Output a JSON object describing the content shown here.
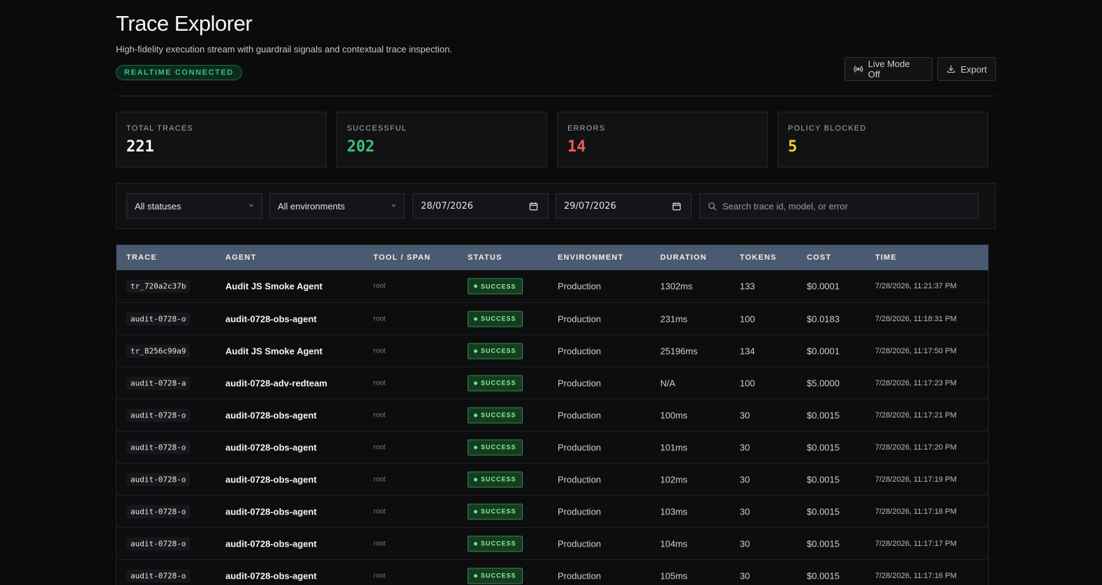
{
  "header": {
    "title": "Trace Explorer",
    "subtitle": "High-fidelity execution stream with guardrail signals and contextual trace inspection.",
    "badge": "REALTIME CONNECTED",
    "live_mode_label": "Live Mode Off",
    "export_label": "Export"
  },
  "stats": [
    {
      "label": "TOTAL TRACES",
      "value": "221",
      "color": "#f5f5f5"
    },
    {
      "label": "SUCCESSFUL",
      "value": "202",
      "color": "#3fbf7a"
    },
    {
      "label": "ERRORS",
      "value": "14",
      "color": "#ef5b5b"
    },
    {
      "label": "POLICY BLOCKED",
      "value": "5",
      "color": "#f2d22e"
    }
  ],
  "filters": {
    "status": "All statuses",
    "environment": "All environments",
    "date_from": "28/07/2026",
    "date_to": "29/07/2026",
    "search_placeholder": "Search trace id, model, or error"
  },
  "table": {
    "columns": [
      "TRACE",
      "AGENT",
      "TOOL / SPAN",
      "STATUS",
      "ENVIRONMENT",
      "DURATION",
      "TOKENS",
      "COST",
      "TIME"
    ],
    "rows": [
      {
        "trace": "tr_720a2c37b",
        "agent": "Audit JS Smoke Agent",
        "tool": "root",
        "status": "SUCCESS",
        "env": "Production",
        "duration": "1302ms",
        "tokens": "133",
        "cost": "$0.0001",
        "time": "7/28/2026, 11:21:37 PM"
      },
      {
        "trace": "audit-0728-o",
        "agent": "audit-0728-obs-agent",
        "tool": "root",
        "status": "SUCCESS",
        "env": "Production",
        "duration": "231ms",
        "tokens": "100",
        "cost": "$0.0183",
        "time": "7/28/2026, 11:18:31 PM"
      },
      {
        "trace": "tr_8256c99a9",
        "agent": "Audit JS Smoke Agent",
        "tool": "root",
        "status": "SUCCESS",
        "env": "Production",
        "duration": "25196ms",
        "tokens": "134",
        "cost": "$0.0001",
        "time": "7/28/2026, 11:17:50 PM"
      },
      {
        "trace": "audit-0728-a",
        "agent": "audit-0728-adv-redteam",
        "tool": "root",
        "status": "SUCCESS",
        "env": "Production",
        "duration": "N/A",
        "tokens": "100",
        "cost": "$5.0000",
        "time": "7/28/2026, 11:17:23 PM"
      },
      {
        "trace": "audit-0728-o",
        "agent": "audit-0728-obs-agent",
        "tool": "root",
        "status": "SUCCESS",
        "env": "Production",
        "duration": "100ms",
        "tokens": "30",
        "cost": "$0.0015",
        "time": "7/28/2026, 11:17:21 PM"
      },
      {
        "trace": "audit-0728-o",
        "agent": "audit-0728-obs-agent",
        "tool": "root",
        "status": "SUCCESS",
        "env": "Production",
        "duration": "101ms",
        "tokens": "30",
        "cost": "$0.0015",
        "time": "7/28/2026, 11:17:20 PM"
      },
      {
        "trace": "audit-0728-o",
        "agent": "audit-0728-obs-agent",
        "tool": "root",
        "status": "SUCCESS",
        "env": "Production",
        "duration": "102ms",
        "tokens": "30",
        "cost": "$0.0015",
        "time": "7/28/2026, 11:17:19 PM"
      },
      {
        "trace": "audit-0728-o",
        "agent": "audit-0728-obs-agent",
        "tool": "root",
        "status": "SUCCESS",
        "env": "Production",
        "duration": "103ms",
        "tokens": "30",
        "cost": "$0.0015",
        "time": "7/28/2026, 11:17:18 PM"
      },
      {
        "trace": "audit-0728-o",
        "agent": "audit-0728-obs-agent",
        "tool": "root",
        "status": "SUCCESS",
        "env": "Production",
        "duration": "104ms",
        "tokens": "30",
        "cost": "$0.0015",
        "time": "7/28/2026, 11:17:17 PM"
      },
      {
        "trace": "audit-0728-o",
        "agent": "audit-0728-obs-agent",
        "tool": "root",
        "status": "SUCCESS",
        "env": "Production",
        "duration": "105ms",
        "tokens": "30",
        "cost": "$0.0015",
        "time": "7/28/2026, 11:17:16 PM"
      }
    ]
  }
}
